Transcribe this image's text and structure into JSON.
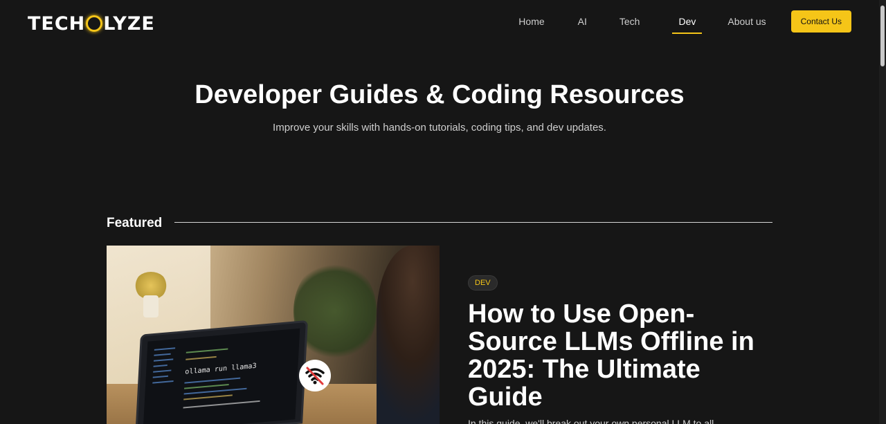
{
  "brand": {
    "logo_text_before": "TECH",
    "logo_text_after": "LYZE",
    "accent": "#f5c518",
    "background": "#161616"
  },
  "nav": {
    "items": [
      {
        "label": "Home",
        "active": false
      },
      {
        "label": "AI",
        "active": false
      },
      {
        "label": "Tech",
        "active": false
      },
      {
        "label": "Dev",
        "active": true
      },
      {
        "label": "About us",
        "active": false
      }
    ],
    "contact_label": "Contact Us"
  },
  "hero": {
    "title": "Developer Guides & Coding Resources",
    "subtitle": "Improve your skills with hands-on tutorials, coding tips, and dev updates."
  },
  "featured": {
    "section_label": "Featured",
    "post": {
      "tag": "DEV",
      "title": "How to Use Open-Source LLMs Offline in 2025: The Ultimate Guide",
      "image_command": "ollama run llama3",
      "image_icon": "wifi-off-icon",
      "excerpt": "In this guide, we'll break out your own personal LLM to all..."
    }
  }
}
